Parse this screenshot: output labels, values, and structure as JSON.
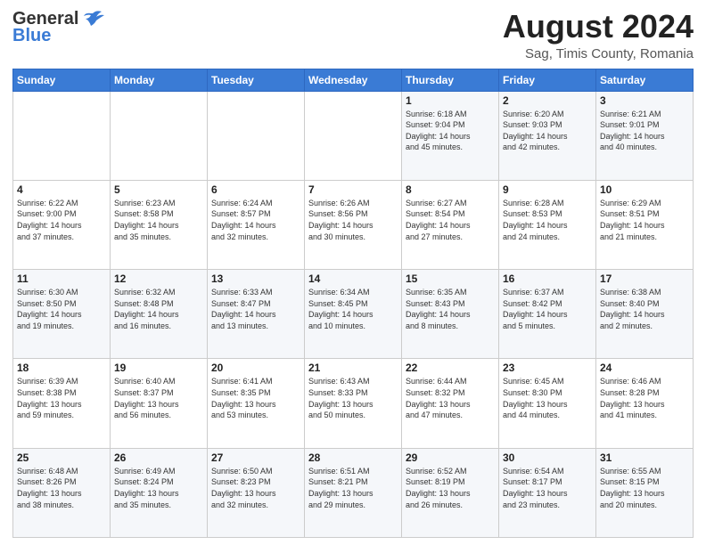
{
  "header": {
    "logo_general": "General",
    "logo_blue": "Blue",
    "month_title": "August 2024",
    "subtitle": "Sag, Timis County, Romania"
  },
  "weekdays": [
    "Sunday",
    "Monday",
    "Tuesday",
    "Wednesday",
    "Thursday",
    "Friday",
    "Saturday"
  ],
  "weeks": [
    [
      {
        "day": "",
        "info": ""
      },
      {
        "day": "",
        "info": ""
      },
      {
        "day": "",
        "info": ""
      },
      {
        "day": "",
        "info": ""
      },
      {
        "day": "1",
        "info": "Sunrise: 6:18 AM\nSunset: 9:04 PM\nDaylight: 14 hours\nand 45 minutes."
      },
      {
        "day": "2",
        "info": "Sunrise: 6:20 AM\nSunset: 9:03 PM\nDaylight: 14 hours\nand 42 minutes."
      },
      {
        "day": "3",
        "info": "Sunrise: 6:21 AM\nSunset: 9:01 PM\nDaylight: 14 hours\nand 40 minutes."
      }
    ],
    [
      {
        "day": "4",
        "info": "Sunrise: 6:22 AM\nSunset: 9:00 PM\nDaylight: 14 hours\nand 37 minutes."
      },
      {
        "day": "5",
        "info": "Sunrise: 6:23 AM\nSunset: 8:58 PM\nDaylight: 14 hours\nand 35 minutes."
      },
      {
        "day": "6",
        "info": "Sunrise: 6:24 AM\nSunset: 8:57 PM\nDaylight: 14 hours\nand 32 minutes."
      },
      {
        "day": "7",
        "info": "Sunrise: 6:26 AM\nSunset: 8:56 PM\nDaylight: 14 hours\nand 30 minutes."
      },
      {
        "day": "8",
        "info": "Sunrise: 6:27 AM\nSunset: 8:54 PM\nDaylight: 14 hours\nand 27 minutes."
      },
      {
        "day": "9",
        "info": "Sunrise: 6:28 AM\nSunset: 8:53 PM\nDaylight: 14 hours\nand 24 minutes."
      },
      {
        "day": "10",
        "info": "Sunrise: 6:29 AM\nSunset: 8:51 PM\nDaylight: 14 hours\nand 21 minutes."
      }
    ],
    [
      {
        "day": "11",
        "info": "Sunrise: 6:30 AM\nSunset: 8:50 PM\nDaylight: 14 hours\nand 19 minutes."
      },
      {
        "day": "12",
        "info": "Sunrise: 6:32 AM\nSunset: 8:48 PM\nDaylight: 14 hours\nand 16 minutes."
      },
      {
        "day": "13",
        "info": "Sunrise: 6:33 AM\nSunset: 8:47 PM\nDaylight: 14 hours\nand 13 minutes."
      },
      {
        "day": "14",
        "info": "Sunrise: 6:34 AM\nSunset: 8:45 PM\nDaylight: 14 hours\nand 10 minutes."
      },
      {
        "day": "15",
        "info": "Sunrise: 6:35 AM\nSunset: 8:43 PM\nDaylight: 14 hours\nand 8 minutes."
      },
      {
        "day": "16",
        "info": "Sunrise: 6:37 AM\nSunset: 8:42 PM\nDaylight: 14 hours\nand 5 minutes."
      },
      {
        "day": "17",
        "info": "Sunrise: 6:38 AM\nSunset: 8:40 PM\nDaylight: 14 hours\nand 2 minutes."
      }
    ],
    [
      {
        "day": "18",
        "info": "Sunrise: 6:39 AM\nSunset: 8:38 PM\nDaylight: 13 hours\nand 59 minutes."
      },
      {
        "day": "19",
        "info": "Sunrise: 6:40 AM\nSunset: 8:37 PM\nDaylight: 13 hours\nand 56 minutes."
      },
      {
        "day": "20",
        "info": "Sunrise: 6:41 AM\nSunset: 8:35 PM\nDaylight: 13 hours\nand 53 minutes."
      },
      {
        "day": "21",
        "info": "Sunrise: 6:43 AM\nSunset: 8:33 PM\nDaylight: 13 hours\nand 50 minutes."
      },
      {
        "day": "22",
        "info": "Sunrise: 6:44 AM\nSunset: 8:32 PM\nDaylight: 13 hours\nand 47 minutes."
      },
      {
        "day": "23",
        "info": "Sunrise: 6:45 AM\nSunset: 8:30 PM\nDaylight: 13 hours\nand 44 minutes."
      },
      {
        "day": "24",
        "info": "Sunrise: 6:46 AM\nSunset: 8:28 PM\nDaylight: 13 hours\nand 41 minutes."
      }
    ],
    [
      {
        "day": "25",
        "info": "Sunrise: 6:48 AM\nSunset: 8:26 PM\nDaylight: 13 hours\nand 38 minutes."
      },
      {
        "day": "26",
        "info": "Sunrise: 6:49 AM\nSunset: 8:24 PM\nDaylight: 13 hours\nand 35 minutes."
      },
      {
        "day": "27",
        "info": "Sunrise: 6:50 AM\nSunset: 8:23 PM\nDaylight: 13 hours\nand 32 minutes."
      },
      {
        "day": "28",
        "info": "Sunrise: 6:51 AM\nSunset: 8:21 PM\nDaylight: 13 hours\nand 29 minutes."
      },
      {
        "day": "29",
        "info": "Sunrise: 6:52 AM\nSunset: 8:19 PM\nDaylight: 13 hours\nand 26 minutes."
      },
      {
        "day": "30",
        "info": "Sunrise: 6:54 AM\nSunset: 8:17 PM\nDaylight: 13 hours\nand 23 minutes."
      },
      {
        "day": "31",
        "info": "Sunrise: 6:55 AM\nSunset: 8:15 PM\nDaylight: 13 hours\nand 20 minutes."
      }
    ]
  ]
}
